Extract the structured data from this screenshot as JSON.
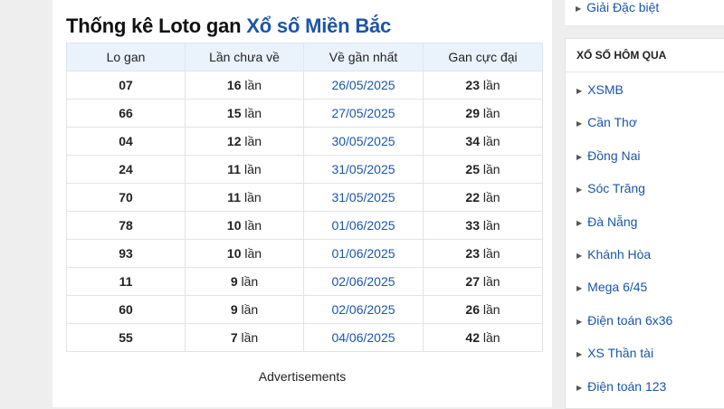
{
  "main": {
    "title_prefix": "Thống kê Loto gan",
    "title_link": "Xổ số Miền Bắc",
    "table": {
      "headers": [
        "Lo gan",
        "Lần chưa về",
        "Về gần nhất",
        "Gan cực đại"
      ],
      "unit": "lần",
      "rows": [
        {
          "lo": "07",
          "chua_ve": "16",
          "ve_gan_nhat": "26/05/2025",
          "gan_cuc_dai": "23"
        },
        {
          "lo": "66",
          "chua_ve": "15",
          "ve_gan_nhat": "27/05/2025",
          "gan_cuc_dai": "29"
        },
        {
          "lo": "04",
          "chua_ve": "12",
          "ve_gan_nhat": "30/05/2025",
          "gan_cuc_dai": "34"
        },
        {
          "lo": "24",
          "chua_ve": "11",
          "ve_gan_nhat": "31/05/2025",
          "gan_cuc_dai": "25"
        },
        {
          "lo": "70",
          "chua_ve": "11",
          "ve_gan_nhat": "31/05/2025",
          "gan_cuc_dai": "22"
        },
        {
          "lo": "78",
          "chua_ve": "10",
          "ve_gan_nhat": "01/06/2025",
          "gan_cuc_dai": "33"
        },
        {
          "lo": "93",
          "chua_ve": "10",
          "ve_gan_nhat": "01/06/2025",
          "gan_cuc_dai": "23"
        },
        {
          "lo": "11",
          "chua_ve": "9",
          "ve_gan_nhat": "02/06/2025",
          "gan_cuc_dai": "27"
        },
        {
          "lo": "60",
          "chua_ve": "9",
          "ve_gan_nhat": "02/06/2025",
          "gan_cuc_dai": "26"
        },
        {
          "lo": "55",
          "chua_ve": "7",
          "ve_gan_nhat": "04/06/2025",
          "gan_cuc_dai": "42"
        }
      ]
    },
    "ads_label": "Advertisements"
  },
  "sidebar": {
    "top_item": "Giải Đặc biệt",
    "header": "XỔ SỐ HÔM QUA",
    "items": [
      "XSMB",
      "Cần Thơ",
      "Đồng Nai",
      "Sóc Trăng",
      "Đà Nẵng",
      "Khánh Hòa",
      "Mega 6/45",
      "Điện toán 6x36",
      "XS Thần tài",
      "Điện toán 123"
    ]
  },
  "colors": {
    "link": "#1a56a8",
    "header_bg": "#eaf3fc",
    "page_bg": "#eeeeee"
  }
}
